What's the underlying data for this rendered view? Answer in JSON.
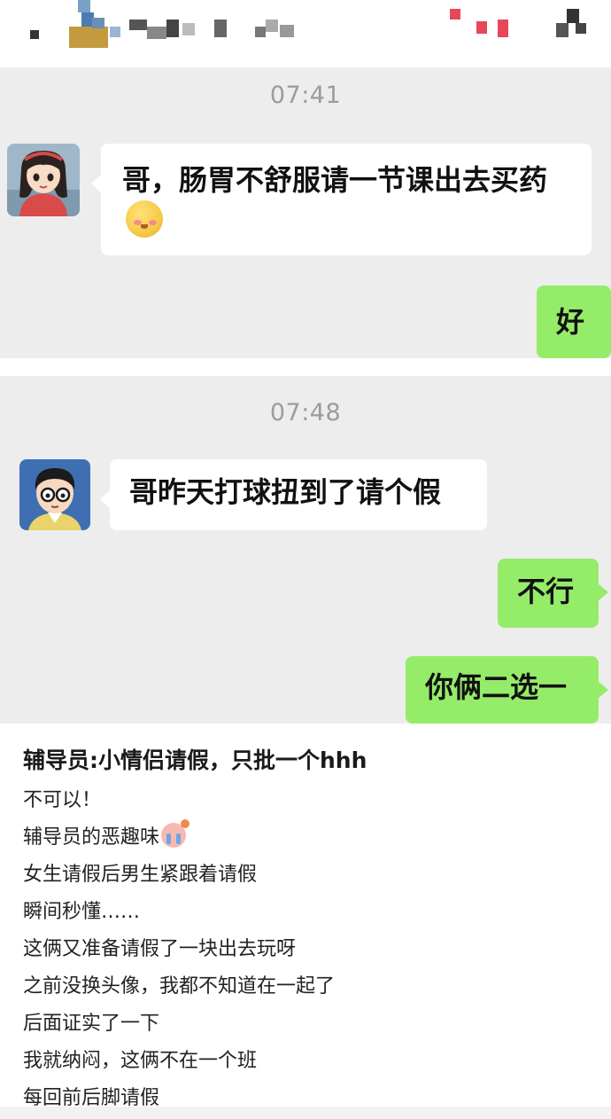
{
  "colors": {
    "chat_bg": "#ededed",
    "incoming_bubble": "#ffffff",
    "outgoing_bubble": "#95ec69",
    "timestamp": "#9c9c9c"
  },
  "chat1": {
    "time": "07:41",
    "incoming": {
      "text": "哥，肠胃不舒服请一节课出去买药",
      "emoji": "flushed-face-emoji",
      "avatar": "girl-avatar"
    },
    "outgoing": [
      "好"
    ]
  },
  "chat2": {
    "time": "07:48",
    "incoming": {
      "text": "哥昨天打球扭到了请个假",
      "avatar": "boy-avatar"
    },
    "outgoing": [
      "不行",
      "你俩二选一"
    ]
  },
  "post": {
    "title": "辅导员:小情侣请假，只批一个hhh",
    "lines": [
      "不可以！",
      "辅导员的恶趣味",
      "女生请假后男生紧跟着请假",
      "瞬间秒懂……",
      "这俩又准备请假了一块出去玩呀",
      "之前没换头像，我都不知道在一起了",
      "后面证实了一下",
      "我就纳闷，这俩不在一个班",
      "每回前后脚请假"
    ],
    "line_emoji": "crying-face-emoji"
  }
}
